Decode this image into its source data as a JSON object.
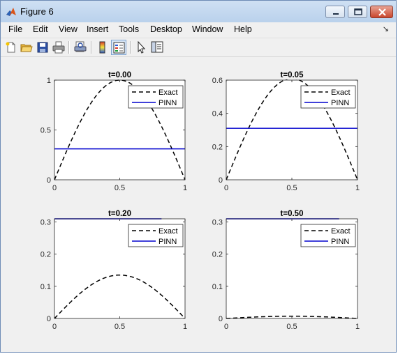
{
  "window": {
    "title": "Figure 6"
  },
  "menu": {
    "items": [
      "File",
      "Edit",
      "View",
      "Insert",
      "Tools",
      "Desktop",
      "Window",
      "Help"
    ]
  },
  "toolbar": {
    "buttons": [
      "new-figure-icon",
      "open-file-icon",
      "save-icon",
      "print-icon",
      "print-preview-icon",
      "colorbar-icon",
      "legend-icon",
      "pointer-icon",
      "property-editor-icon"
    ]
  },
  "colors": {
    "exact": "#000000",
    "pinn": "#0000cd"
  },
  "chart_data": [
    {
      "type": "line",
      "title": "t=0.00",
      "xlim": [
        0,
        1
      ],
      "ylim": [
        0,
        1
      ],
      "xticks": [
        "0",
        "0.5",
        "1"
      ],
      "yticks": [
        "0",
        "0.5",
        "1"
      ],
      "legend": {
        "position": "top-right",
        "entries": [
          "Exact",
          "PINN"
        ]
      },
      "series": [
        {
          "name": "Exact",
          "style": "dashed",
          "color": "#000000",
          "function": "sin",
          "amplitude": 1.0
        },
        {
          "name": "PINN",
          "style": "solid",
          "color": "#0000cd",
          "constant": 0.31
        }
      ]
    },
    {
      "type": "line",
      "title": "t=0.05",
      "xlim": [
        0,
        1
      ],
      "ylim": [
        0,
        0.6
      ],
      "xticks": [
        "0",
        "0.5",
        "1"
      ],
      "yticks": [
        "0",
        "0.2",
        "0.4",
        "0.6"
      ],
      "legend": {
        "position": "top-right",
        "entries": [
          "Exact",
          "PINN"
        ]
      },
      "series": [
        {
          "name": "Exact",
          "style": "dashed",
          "color": "#000000",
          "function": "sin",
          "amplitude": 0.61
        },
        {
          "name": "PINN",
          "style": "solid",
          "color": "#0000cd",
          "constant": 0.31
        }
      ]
    },
    {
      "type": "line",
      "title": "t=0.20",
      "xlim": [
        0,
        1
      ],
      "ylim": [
        0,
        0.31
      ],
      "xticks": [
        "0",
        "0.5",
        "1"
      ],
      "yticks": [
        "0",
        "0.1",
        "0.2",
        "0.3"
      ],
      "legend": {
        "position": "top-right",
        "entries": [
          "Exact",
          "PINN"
        ]
      },
      "series": [
        {
          "name": "Exact",
          "style": "dashed",
          "color": "#000000",
          "function": "sin",
          "amplitude": 0.135
        },
        {
          "name": "PINN",
          "style": "solid",
          "color": "#0000cd",
          "constant": 0.31,
          "x_end": 0.82
        }
      ]
    },
    {
      "type": "line",
      "title": "t=0.50",
      "xlim": [
        0,
        1
      ],
      "ylim": [
        0,
        0.31
      ],
      "xticks": [
        "0",
        "0.5",
        "1"
      ],
      "yticks": [
        "0",
        "0.1",
        "0.2",
        "0.3"
      ],
      "legend": {
        "position": "top-right",
        "entries": [
          "Exact",
          "PINN"
        ]
      },
      "series": [
        {
          "name": "Exact",
          "style": "dashed",
          "color": "#000000",
          "function": "sin",
          "amplitude": 0.007
        },
        {
          "name": "PINN",
          "style": "solid",
          "color": "#0000cd",
          "constant": 0.31,
          "x_end": 0.86
        }
      ]
    }
  ]
}
